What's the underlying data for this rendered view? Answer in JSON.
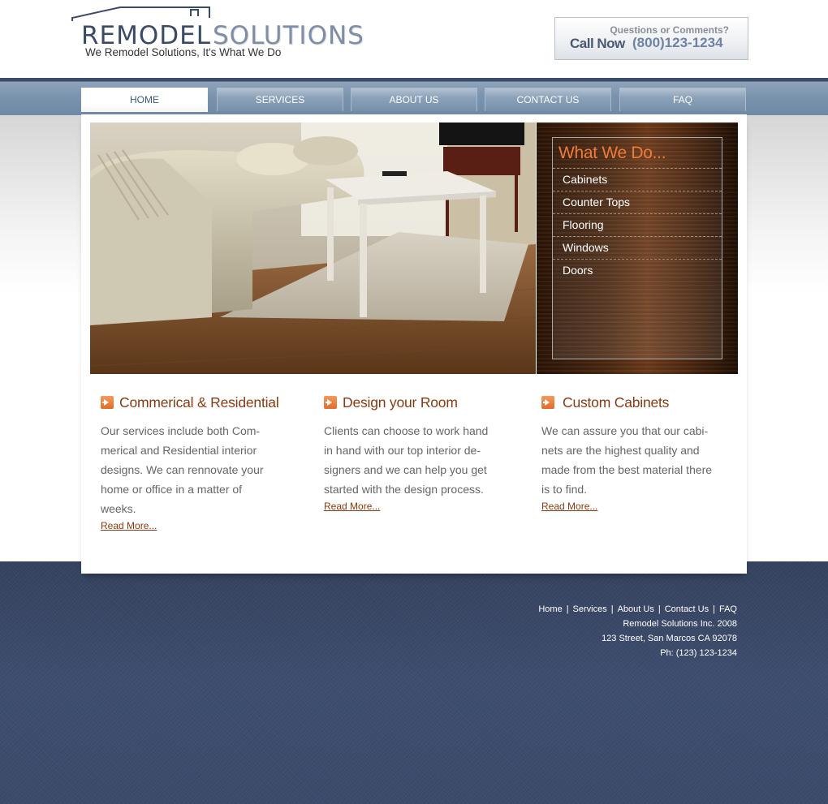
{
  "header": {
    "logo_word1": "REMODEL",
    "logo_word2": "SOLUTIONS",
    "tagline": "We Remodel Solutions, It's What We Do",
    "call_question": "Questions or Comments?",
    "call_now": "Call Now",
    "phone": "(800)123-1234"
  },
  "nav": {
    "items": [
      {
        "label": "HOME"
      },
      {
        "label": "SERVICES"
      },
      {
        "label": "ABOUT US"
      },
      {
        "label": "CONTACT US"
      },
      {
        "label": "FAQ"
      }
    ]
  },
  "what_we_do": {
    "title": "What We Do...",
    "items": [
      "Cabinets",
      "Counter Tops",
      "Flooring",
      "Windows",
      "Doors"
    ]
  },
  "columns": [
    {
      "title": "Commerical & Residential",
      "text": "Our services include both Com-merical and Residential interior designs. We can rennovate your home or office in a matter of weeks.",
      "read_more": "Read More..."
    },
    {
      "title": "Design your Room",
      "text": "Clients can choose to work hand in hand with our top interior de-signers and we can help you get started with the design process.",
      "read_more": "Read More..."
    },
    {
      "title": "Custom Cabinets",
      "text": "We can assure you that our cabi-nets are the highest quality and made from the best material there is to find.",
      "read_more": "Read More..."
    }
  ],
  "footer": {
    "links": [
      "Home",
      "Services",
      "About Us",
      "Contact Us",
      "FAQ"
    ],
    "company": "Remodel Solutions Inc. 2008",
    "address": "123 Street, San Marcos CA 92078",
    "phone": "Ph: (123) 123-1234"
  },
  "colors": {
    "accent_orange": "#e36a2a",
    "heading_brown": "#8a3a10",
    "nav_blue": "#7790ab",
    "footer_denim": "#3a4a69"
  }
}
